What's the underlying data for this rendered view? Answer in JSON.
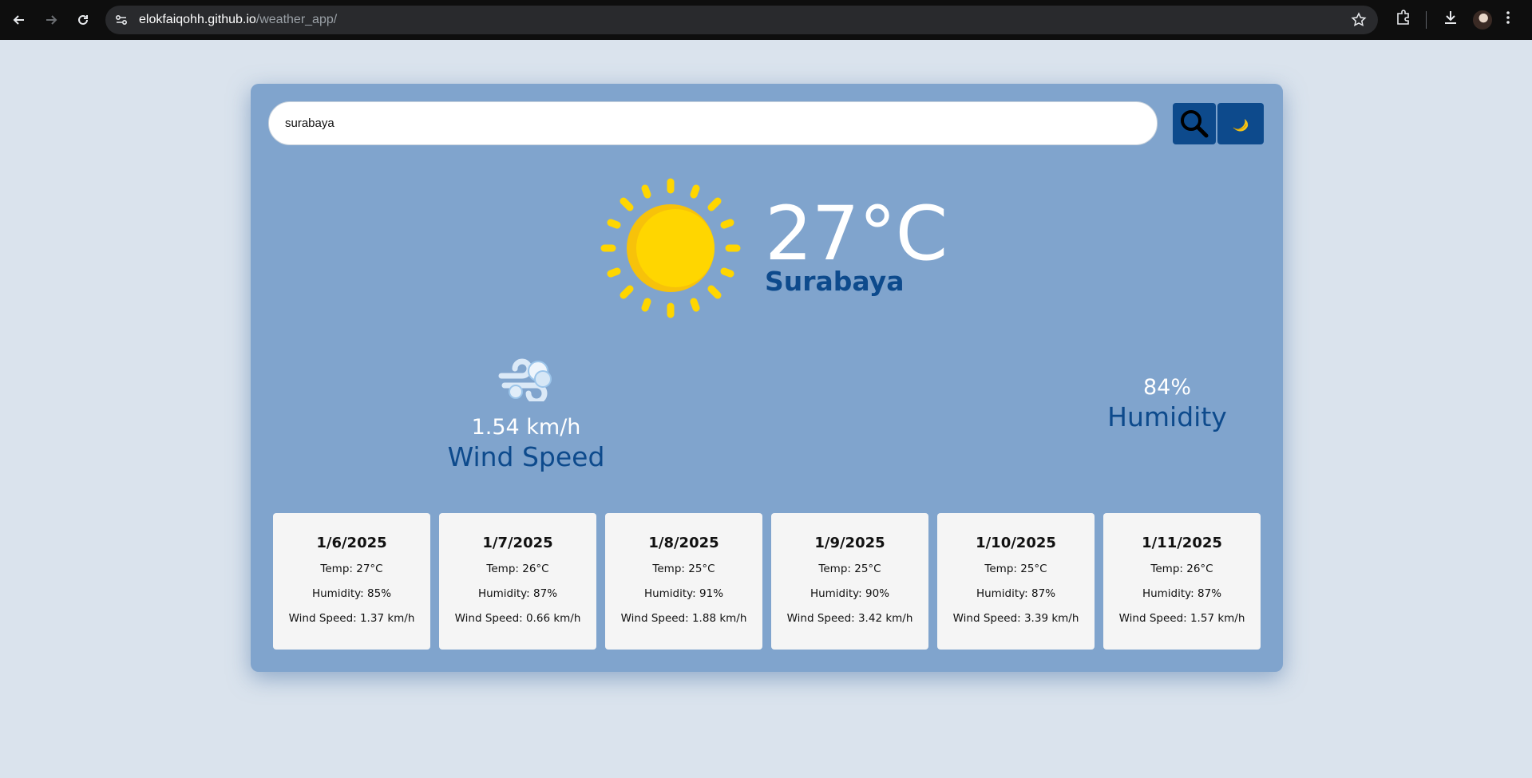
{
  "browser": {
    "url_host": "elokfaiqohh.github.io",
    "url_path": "/weather_app/"
  },
  "search": {
    "value": "surabaya",
    "placeholder": ""
  },
  "current": {
    "temperature": "27°C",
    "city": "Surabaya",
    "condition_icon": "sun-icon"
  },
  "wind": {
    "value": "1.54 km/h",
    "label": "Wind Speed",
    "icon": "wind-icon"
  },
  "humidity": {
    "value": "84%",
    "label": "Humidity"
  },
  "forecast": [
    {
      "date": "1/6/2025",
      "temp": "Temp: 27°C",
      "humidity": "Humidity: 85%",
      "wind": "Wind Speed: 1.37 km/h"
    },
    {
      "date": "1/7/2025",
      "temp": "Temp: 26°C",
      "humidity": "Humidity: 87%",
      "wind": "Wind Speed: 0.66 km/h"
    },
    {
      "date": "1/8/2025",
      "temp": "Temp: 25°C",
      "humidity": "Humidity: 91%",
      "wind": "Wind Speed: 1.88 km/h"
    },
    {
      "date": "1/9/2025",
      "temp": "Temp: 25°C",
      "humidity": "Humidity: 90%",
      "wind": "Wind Speed: 3.42 km/h"
    },
    {
      "date": "1/10/2025",
      "temp": "Temp: 25°C",
      "humidity": "Humidity: 87%",
      "wind": "Wind Speed: 3.39 km/h"
    },
    {
      "date": "1/11/2025",
      "temp": "Temp: 26°C",
      "humidity": "Humidity: 87%",
      "wind": "Wind Speed: 1.57 km/h"
    }
  ],
  "colors": {
    "page_bg": "#dae3ed",
    "card_bg": "#80a4cd",
    "accent": "#0d4a8c",
    "sun": "#ffd600"
  }
}
